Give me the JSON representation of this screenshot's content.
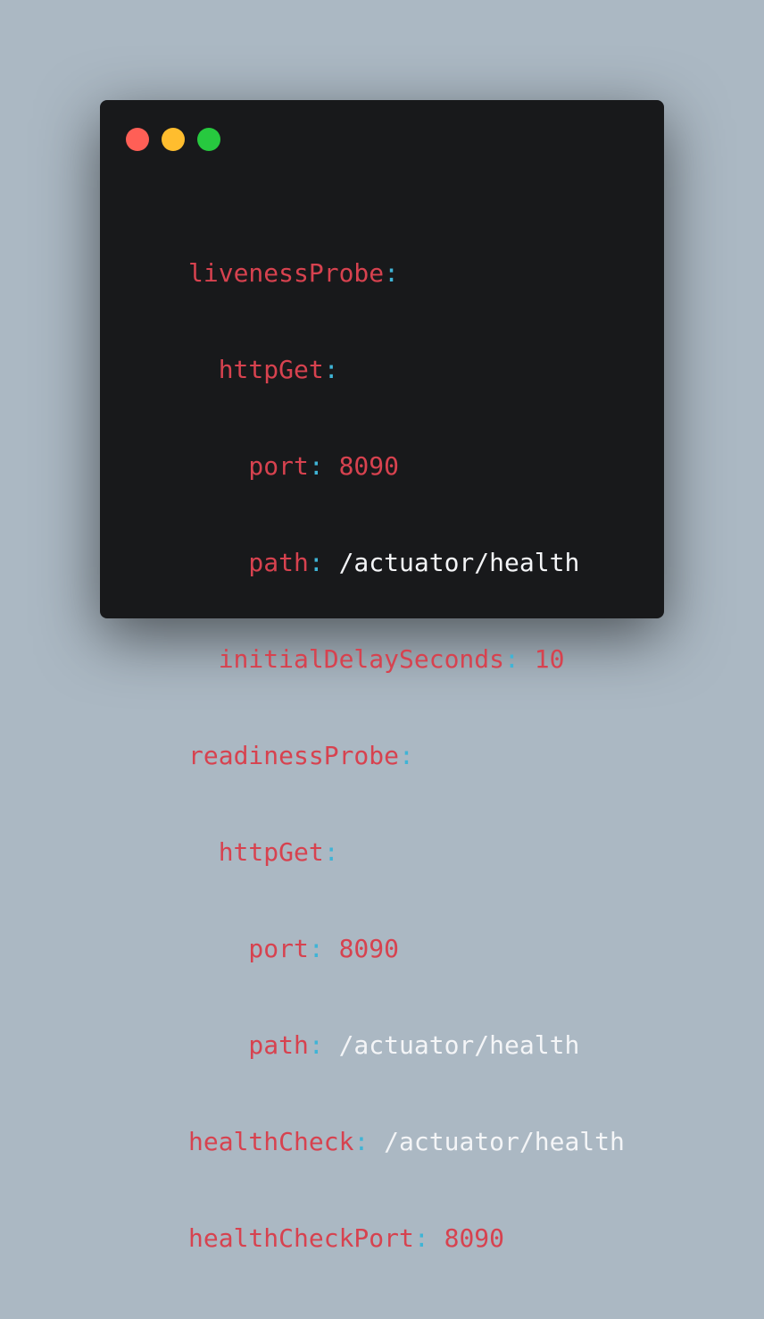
{
  "colors": {
    "background": "#abb8c3",
    "window": "#18191b",
    "key": "#d7424f",
    "punctuation": "#3fb4d6",
    "number": "#d7424f",
    "string": "#f4f5f7",
    "close_dot": "#ff5f56",
    "minimize_dot": "#ffbd2e",
    "maximize_dot": "#27c93f"
  },
  "code": {
    "lines": [
      {
        "indent": 0,
        "key": "livenessProbe",
        "colon": ":",
        "value": "",
        "value_type": "none"
      },
      {
        "indent": 1,
        "key": "httpGet",
        "colon": ":",
        "value": "",
        "value_type": "none"
      },
      {
        "indent": 2,
        "key": "port",
        "colon": ":",
        "value": "8090",
        "value_type": "num"
      },
      {
        "indent": 2,
        "key": "path",
        "colon": ":",
        "value": "/actuator/health",
        "value_type": "str"
      },
      {
        "indent": 1,
        "key": "initialDelaySeconds",
        "colon": ":",
        "value": "10",
        "value_type": "num"
      },
      {
        "indent": 0,
        "key": "readinessProbe",
        "colon": ":",
        "value": "",
        "value_type": "none"
      },
      {
        "indent": 1,
        "key": "httpGet",
        "colon": ":",
        "value": "",
        "value_type": "none"
      },
      {
        "indent": 2,
        "key": "port",
        "colon": ":",
        "value": "8090",
        "value_type": "num"
      },
      {
        "indent": 2,
        "key": "path",
        "colon": ":",
        "value": "/actuator/health",
        "value_type": "str"
      },
      {
        "indent": 0,
        "key": "healthCheck",
        "colon": ":",
        "value": "/actuator/health",
        "value_type": "str"
      },
      {
        "indent": 0,
        "key": "healthCheckPort",
        "colon": ":",
        "value": "8090",
        "value_type": "num"
      }
    ]
  }
}
